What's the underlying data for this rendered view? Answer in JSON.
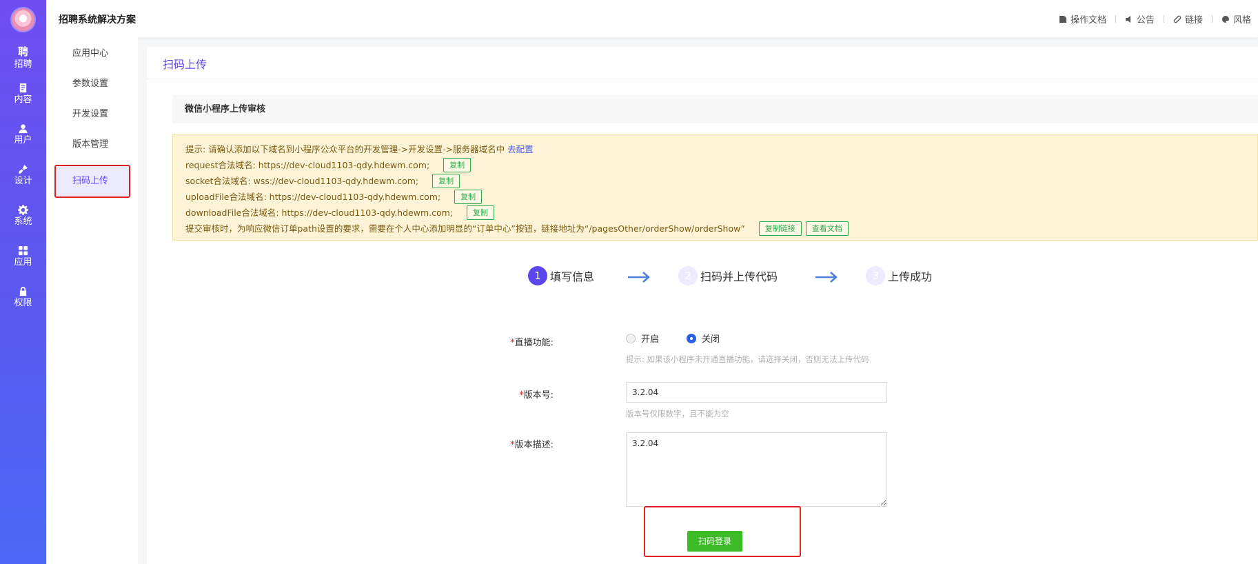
{
  "app": {
    "title": "招聘系统解决方案"
  },
  "rail": {
    "items": [
      {
        "icon": "聘",
        "label": "招聘"
      },
      {
        "icon": "document-icon",
        "label": "内容"
      },
      {
        "icon": "user-icon",
        "label": "用户"
      },
      {
        "icon": "brush-icon",
        "label": "设计"
      },
      {
        "icon": "gear-icon",
        "label": "系统"
      },
      {
        "icon": "grid-icon",
        "label": "应用"
      },
      {
        "icon": "lock-icon",
        "label": "权限"
      }
    ]
  },
  "header": {
    "links": [
      {
        "icon": "doc-icon",
        "label": "操作文档"
      },
      {
        "icon": "speaker-icon",
        "label": "公告"
      },
      {
        "icon": "link-icon",
        "label": "链接"
      },
      {
        "icon": "palette-icon",
        "label": "风格"
      }
    ]
  },
  "subnav": {
    "items": [
      {
        "label": "应用中心"
      },
      {
        "label": "参数设置"
      },
      {
        "label": "开发设置"
      },
      {
        "label": "版本管理"
      },
      {
        "label": "扫码上传"
      }
    ],
    "active_index": 4
  },
  "main": {
    "page_title": "扫码上传",
    "section_title": "微信小程序上传审核",
    "notice": {
      "tip_text": "提示: 请确认添加以下域名到小程序公众平台的开发管理->开发设置->服务器域名中",
      "tip_link": "去配置",
      "domains": [
        {
          "text": "request合法域名: https://dev-cloud1103-qdy.hdewm.com;",
          "button": "复制"
        },
        {
          "text": "socket合法域名: wss://dev-cloud1103-qdy.hdewm.com;",
          "button": "复制"
        },
        {
          "text": "uploadFile合法域名: https://dev-cloud1103-qdy.hdewm.com;",
          "button": "复制"
        },
        {
          "text": "downloadFile合法域名: https://dev-cloud1103-qdy.hdewm.com;",
          "button": "复制"
        }
      ],
      "submit_text": "提交审核时，为响应微信订单path设置的要求，需要在个人中心添加明显的“订单中心”按钮，链接地址为“/pagesOther/orderShow/orderShow”",
      "copy_link_button": "复制链接",
      "view_doc_button": "查看文档"
    },
    "steps": [
      {
        "num": "1",
        "label": "填写信息",
        "done": true
      },
      {
        "num": "2",
        "label": "扫码并上传代码",
        "done": false
      },
      {
        "num": "3",
        "label": "上传成功",
        "done": false
      }
    ],
    "form": {
      "live": {
        "label": "直播功能:",
        "options": [
          "开启",
          "关闭"
        ],
        "selected": "关闭",
        "hint": "提示: 如果该小程序未开通直播功能，请选择关闭，否则无法上传代码"
      },
      "version": {
        "label": "版本号:",
        "value": "3.2.04",
        "hint": "版本号仅限数字，且不能为空"
      },
      "description": {
        "label": "版本描述:",
        "value": "3.2.04"
      },
      "submit_button": "扫码登录"
    }
  },
  "colors": {
    "accent": "#5b46f0",
    "highlight": "#e02020",
    "success": "#3cbb27",
    "notice_bg": "#fdf4d8"
  }
}
